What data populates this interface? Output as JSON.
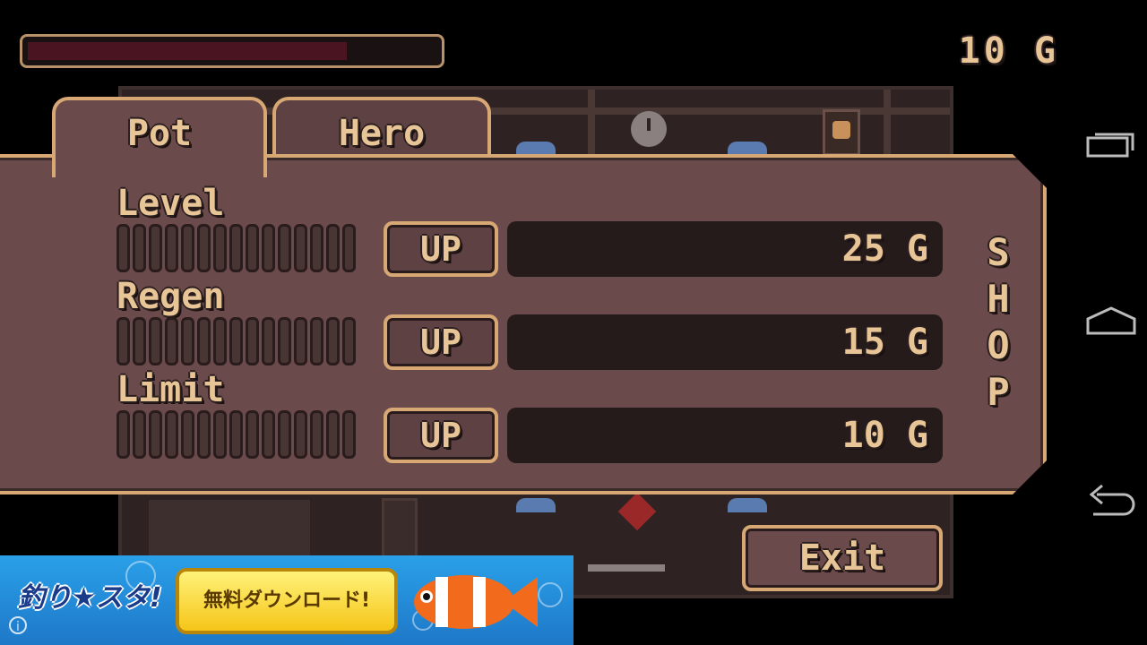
{
  "hud": {
    "gold": "10 G",
    "health_fraction": 0.77
  },
  "tabs": [
    {
      "label": "Pot"
    },
    {
      "label": "Hero"
    }
  ],
  "stats": [
    {
      "label": "Level",
      "button": "UP",
      "price": "25 G"
    },
    {
      "label": "Regen",
      "button": "UP",
      "price": "15 G"
    },
    {
      "label": "Limit",
      "button": "UP",
      "price": "10 G"
    }
  ],
  "shop_letters": [
    "S",
    "H",
    "O",
    "P"
  ],
  "exit_label": "Exit",
  "ad": {
    "logo": "釣り★スタ!",
    "button_label": "無料ダウンロード!"
  },
  "nav": {
    "icons": [
      "recent-apps-icon",
      "home-icon",
      "back-icon"
    ]
  },
  "colors": {
    "accent_border": "#d8a874",
    "panel": "#6b4a4b",
    "text": "#e8c596",
    "health": "#4a1420"
  }
}
